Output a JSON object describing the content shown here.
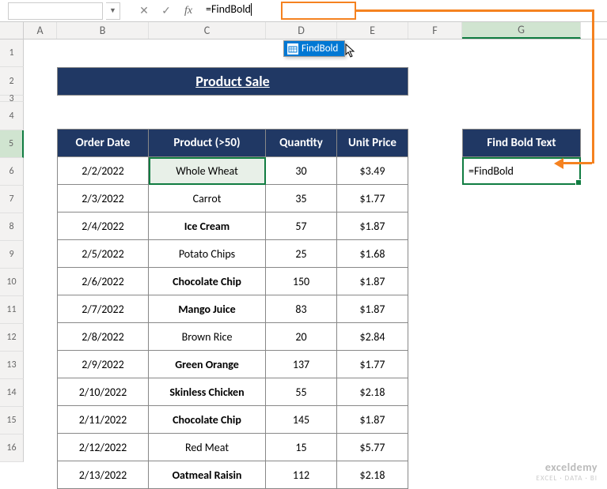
{
  "formula_bar": {
    "namebox_value": "",
    "formula_text": "=FindBold"
  },
  "columns": [
    "A",
    "B",
    "C",
    "D",
    "E",
    "F",
    "G"
  ],
  "rows": [
    "1",
    "2",
    "3",
    "4",
    "5",
    "6",
    "7",
    "8",
    "9",
    "10",
    "11",
    "12",
    "13",
    "14",
    "15",
    "16"
  ],
  "title": "Product Sale",
  "headers": {
    "order_date": "Order Date",
    "product": "Product (>50)",
    "quantity": "Quantity",
    "unit_price": "Unit Price"
  },
  "table": [
    {
      "date": "2/2/2022",
      "product": "Whole Wheat",
      "qty": "30",
      "price": "$3.49",
      "bold": false
    },
    {
      "date": "2/3/2022",
      "product": "Carrot",
      "qty": "35",
      "price": "$1.77",
      "bold": false
    },
    {
      "date": "2/4/2022",
      "product": "Ice Cream",
      "qty": "57",
      "price": "$1.87",
      "bold": true
    },
    {
      "date": "2/5/2022",
      "product": "Potato Chips",
      "qty": "25",
      "price": "$1.68",
      "bold": false
    },
    {
      "date": "2/6/2022",
      "product": "Chocolate Chip",
      "qty": "150",
      "price": "$1.87",
      "bold": true
    },
    {
      "date": "2/7/2022",
      "product": "Mango Juice",
      "qty": "83",
      "price": "$1.87",
      "bold": true
    },
    {
      "date": "2/8/2022",
      "product": "Brown Rice",
      "qty": "20",
      "price": "$2.84",
      "bold": false
    },
    {
      "date": "2/9/2022",
      "product": "Green Orange",
      "qty": "137",
      "price": "$1.77",
      "bold": true
    },
    {
      "date": "2/10/2022",
      "product": "Skinless Chicken",
      "qty": "55",
      "price": "$2.18",
      "bold": true
    },
    {
      "date": "2/11/2022",
      "product": "Chocolate Chip",
      "qty": "145",
      "price": "$1.87",
      "bold": true
    },
    {
      "date": "2/12/2022",
      "product": "Red Meat",
      "qty": "15",
      "price": "$5.77",
      "bold": false
    },
    {
      "date": "2/13/2022",
      "product": "Oatmeal Raisin",
      "qty": "112",
      "price": "$2.18",
      "bold": true
    }
  ],
  "g_block": {
    "header": "Find Bold Text",
    "cell_value": "=FindBold"
  },
  "autocomplete": {
    "item": "FindBold"
  },
  "watermark": {
    "line1": "exceldemy",
    "line2": "EXCEL · DATA · BI"
  },
  "icons": {
    "cancel": "✕",
    "enter": "✓",
    "dropdown": "▼"
  }
}
